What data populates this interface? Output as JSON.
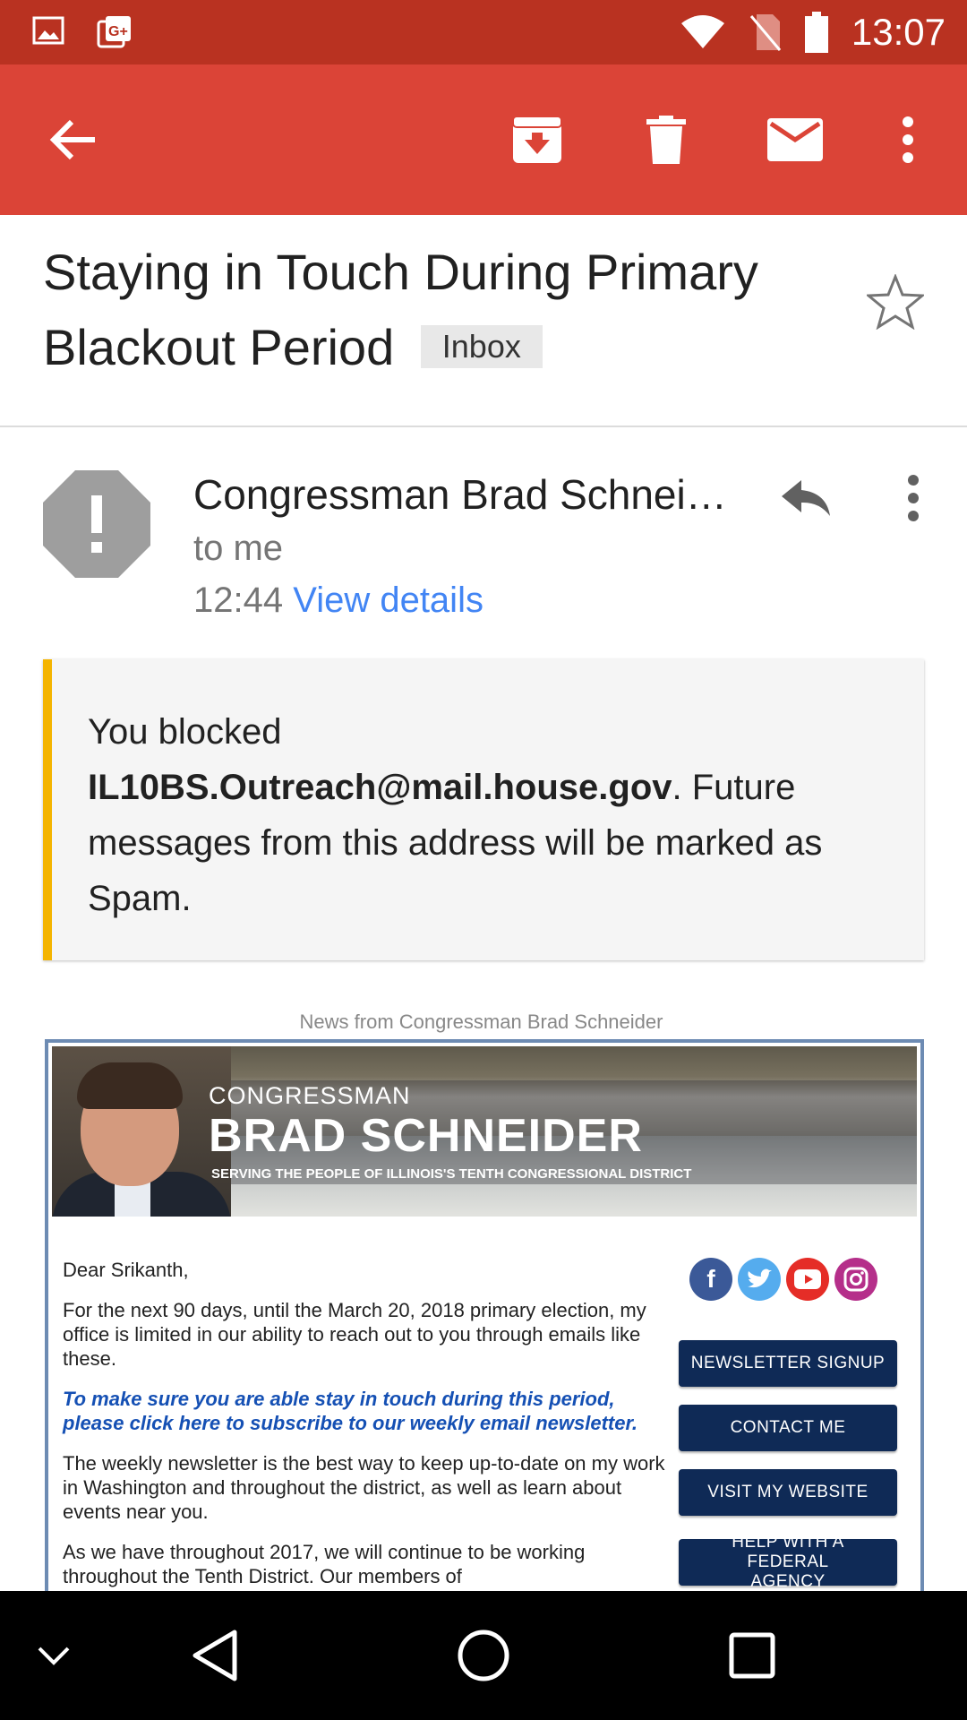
{
  "status_bar": {
    "time": "13:07"
  },
  "toolbar": {
    "back": "back-arrow-icon",
    "archive": "archive-icon",
    "delete": "trash-icon",
    "mark_unread": "mail-icon",
    "more": "more-vert-icon"
  },
  "message": {
    "subject": "Staying in Touch During Primary Blackout Period",
    "label": "Inbox",
    "sender": "Congressman Brad Schnei…",
    "recipient": "to me",
    "time": "12:44",
    "view_details": "View details"
  },
  "notice": {
    "prefix": "You blocked",
    "address": "IL10BS.Outreach@mail.house.gov",
    "suffix": ". Future messages from this address will be marked as Spam."
  },
  "email": {
    "news_from": "News from Congressman Brad Schneider",
    "banner": {
      "small": "CONGRESSMAN",
      "big": "BRAD SCHNEIDER",
      "tagline": "SERVING THE PEOPLE OF ILLINOIS'S TENTH CONGRESSIONAL DISTRICT"
    },
    "greeting": "Dear Srikanth,",
    "para1": "For the next 90 days, until the March 20, 2018 primary election, my office is limited in our ability to reach out to you through emails like these.",
    "cta": "To make sure you are able stay in touch during this period, please click here to subscribe to our weekly email newsletter.",
    "para2": "The weekly newsletter is the best way to keep up-to-date on my work in Washington and throughout the district, as well as learn about events near you.",
    "para3": "As we have throughout 2017, we will continue to be working throughout the Tenth District. Our members of",
    "buttons": [
      "NEWSLETTER SIGNUP",
      "CONTACT ME",
      "VISIT MY WEBSITE",
      "HELP WITH A FEDERAL AGENCY"
    ],
    "social": [
      "facebook-icon",
      "twitter-icon",
      "youtube-icon",
      "instagram-icon"
    ]
  },
  "colors": {
    "status_bar": "#b93221",
    "app_bar": "#db4437",
    "link": "#4285f4",
    "notice_accent": "#f4b400",
    "button_navy": "#0f2a56"
  }
}
